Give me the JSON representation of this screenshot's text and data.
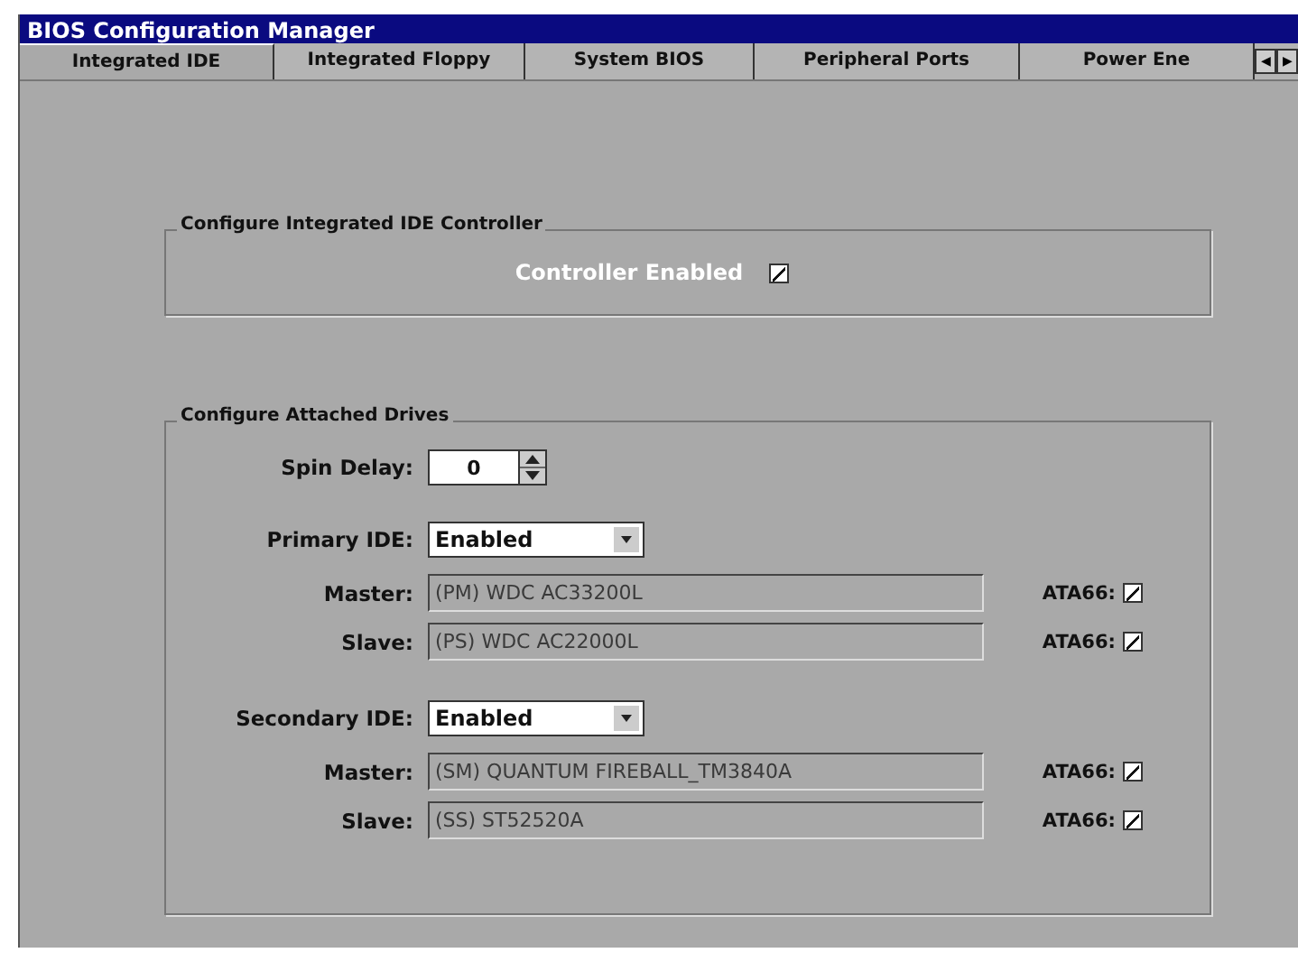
{
  "window": {
    "title": "BIOS Configuration Manager"
  },
  "tabs": [
    {
      "label": "Integrated IDE",
      "selected": true
    },
    {
      "label": "Integrated Floppy",
      "selected": false
    },
    {
      "label": "System BIOS",
      "selected": false
    },
    {
      "label": "Peripheral Ports",
      "selected": false
    },
    {
      "label": "Power Ene",
      "selected": false
    }
  ],
  "tab_scroll": [
    "◀",
    "▶"
  ],
  "controller_group": {
    "title": "Configure Integrated IDE Controller",
    "label": "Controller Enabled",
    "checked": true
  },
  "drives_group": {
    "title": "Configure Attached Drives",
    "spin_delay": {
      "label": "Spin Delay:",
      "value": "0"
    },
    "channels": [
      {
        "label": "Primary IDE:",
        "value": "Enabled",
        "drives": [
          {
            "label": "Master:",
            "value": "(PM) WDC AC33200L",
            "ata_label": "ATA66:",
            "checked": true
          },
          {
            "label": "Slave:",
            "value": "(PS) WDC AC22000L",
            "ata_label": "ATA66:",
            "checked": true
          }
        ]
      },
      {
        "label": "Secondary IDE:",
        "value": "Enabled",
        "drives": [
          {
            "label": "Master:",
            "value": "(SM) QUANTUM FIREBALL_TM3840A",
            "ata_label": "ATA66:",
            "checked": true
          },
          {
            "label": "Slave:",
            "value": "(SS) ST52520A",
            "ata_label": "ATA66:",
            "checked": true
          }
        ]
      }
    ]
  }
}
